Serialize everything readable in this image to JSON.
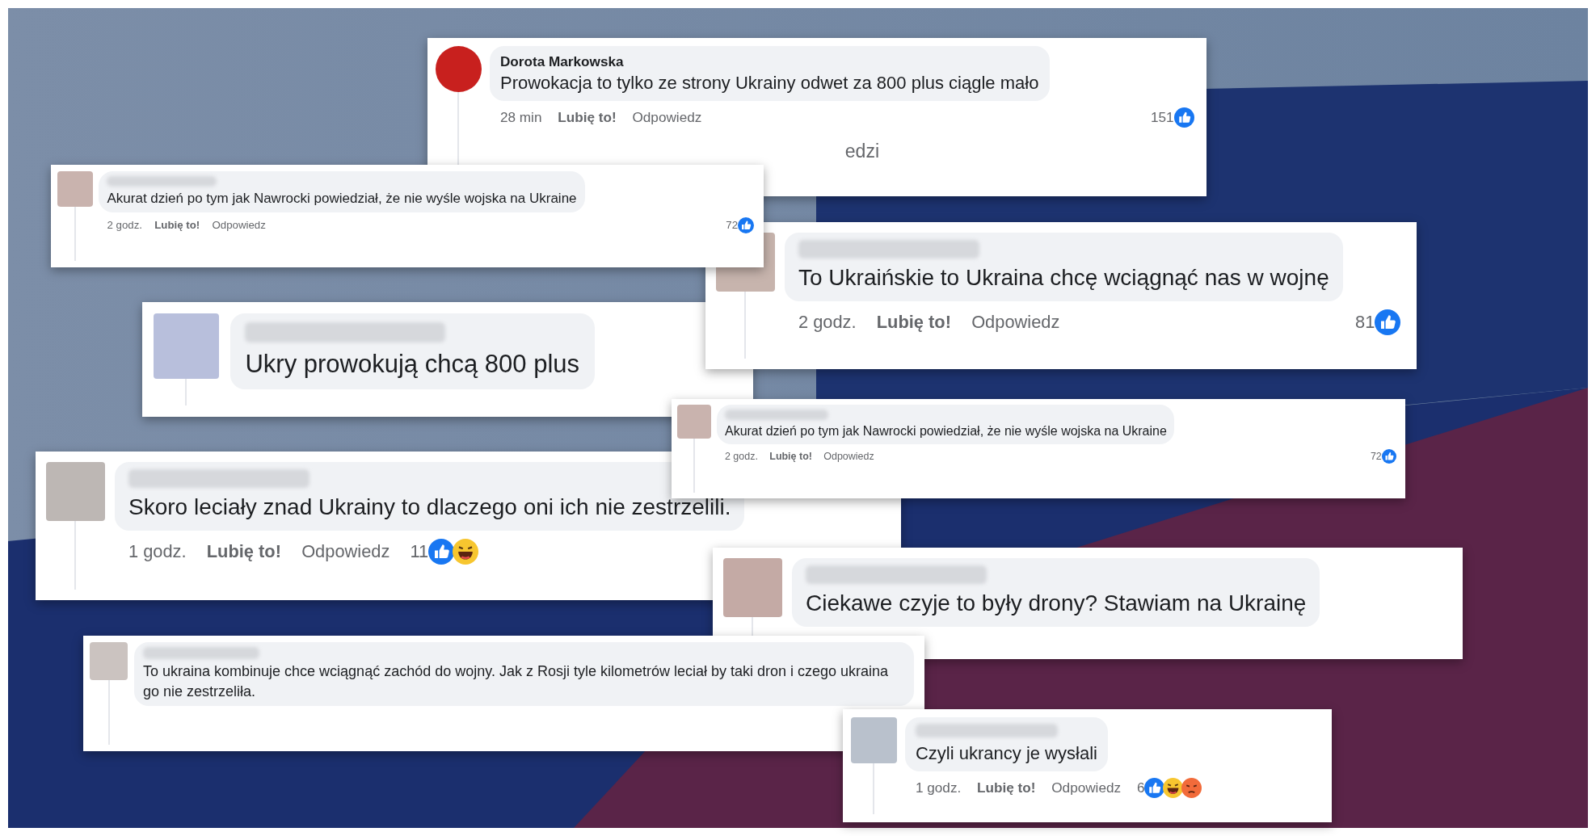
{
  "comments": [
    {
      "name": "Dorota Markowska",
      "color": "#c8201e",
      "text": "Prowokacja to tylko ze strony Ukrainy odwet za 800 plus ciągle mało",
      "footer": {
        "time": "28 min",
        "like": "Lubię to!",
        "reply": "Odpowiedz",
        "count": "151",
        "reactions": [
          {
            "kind": "like"
          }
        ]
      },
      "replies_link": "edzi"
    },
    {
      "color": "#c9b3ae",
      "text": "Akurat dzień po tym jak Nawrocki powiedział, że nie wyśle wojska na Ukraine",
      "footer": {
        "time": "2 godz.",
        "like": "Lubię to!",
        "reply": "Odpowiedz",
        "count": "72",
        "reactions": [
          {
            "kind": "like"
          }
        ]
      }
    },
    {
      "color": "#c7b4ad",
      "text": "To Ukraińskie to Ukraina chcę wciągnąć nas w wojnę",
      "footer": {
        "time": "2 godz.",
        "like": "Lubię to!",
        "reply": "Odpowiedz",
        "count": "81",
        "reactions": [
          {
            "kind": "like"
          }
        ]
      }
    },
    {
      "color": "#b8bfdc",
      "text": "Ukry prowokują chcą 800 plus"
    },
    {
      "color": "#c9b3ae",
      "text": "Akurat dzień po tym jak Nawrocki powiedział, że nie wyśle wojska na Ukraine",
      "footer": {
        "time": "2 godz.",
        "like": "Lubię to!",
        "reply": "Odpowiedz",
        "count": "72",
        "reactions": [
          {
            "kind": "like"
          }
        ]
      }
    },
    {
      "color": "#bdb7b4",
      "text": "Skoro leciały znad Ukrainy to dlaczego oni ich nie zestrzelili.",
      "footer": {
        "time": "1 godz.",
        "like": "Lubię to!",
        "reply": "Odpowiedz",
        "count": "11",
        "reactions": [
          {
            "kind": "like"
          },
          {
            "kind": "haha"
          }
        ]
      }
    },
    {
      "color": "#c4aaa5",
      "text": "Ciekawe czyje to były drony? Stawiam na Ukrainę"
    },
    {
      "color": "#cbc3c0",
      "text": "To ukraina kombinuje chce wciągnąć zachód do wojny. Jak z Rosji tyle kilometrów leciał by taki dron i czego ukraina go nie zestrzeliła."
    },
    {
      "color": "#b9c1cc",
      "text": "Czyli ukrancy je wysłali",
      "footer": {
        "time": "1 godz.",
        "like": "Lubię to!",
        "reply": "Odpowiedz",
        "count": "6",
        "reactions": [
          {
            "kind": "like"
          },
          {
            "kind": "haha"
          },
          {
            "kind": "angry"
          }
        ]
      }
    }
  ]
}
